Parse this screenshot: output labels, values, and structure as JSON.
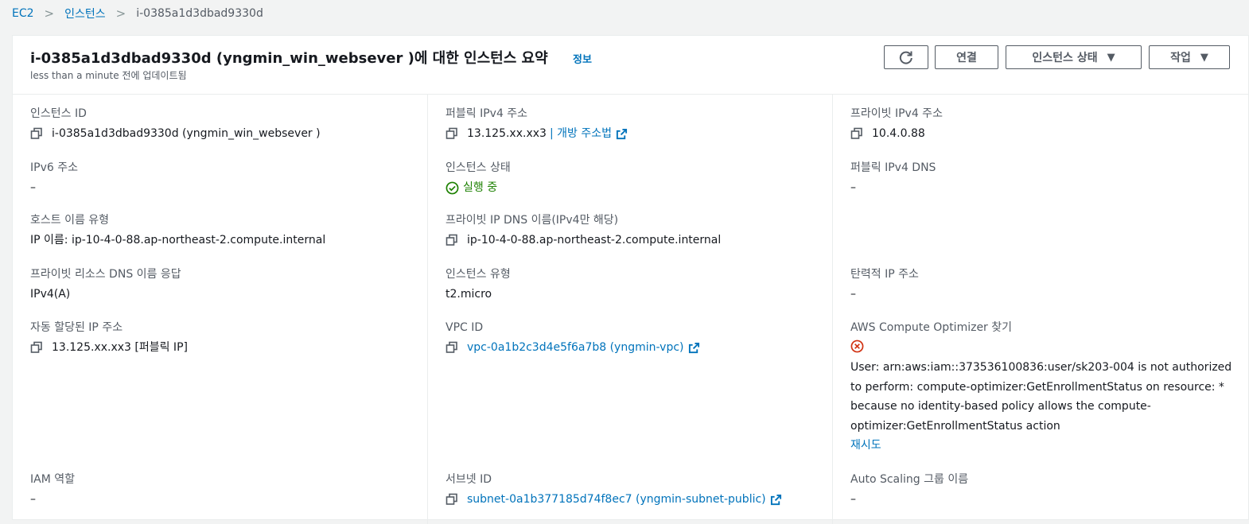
{
  "breadcrumb": {
    "ec2": "EC2",
    "instances": "인스턴스",
    "current": "i-0385a1d3dbad9330d",
    "separator": ">"
  },
  "header": {
    "title": "i-0385a1d3dbad9330d (yngmin_win_websever )에 대한 인스턴스 요약",
    "info_link": "정보",
    "updated": "less than a minute 전에 업데이트됨",
    "refresh_icon": "refresh-icon",
    "connect_button": "연결",
    "instance_state_button": "인스턴스 상태",
    "actions_button": "작업",
    "dropdown_icon": "▼"
  },
  "colors": {
    "link": "#0073bb",
    "success": "#1d8102",
    "error": "#d13212",
    "label": "#545b64",
    "text": "#16191f"
  },
  "details": {
    "instance_id": {
      "label": "인스턴스 ID",
      "value": "i-0385a1d3dbad9330d (yngmin_win_websever )"
    },
    "public_ipv4": {
      "label": "퍼블릭 IPv4 주소",
      "value": "13.125.xx.xx3",
      "link": "| 개방 주소법"
    },
    "private_ipv4": {
      "label": "프라이빗 IPv4 주소",
      "value": "10.4.0.88"
    },
    "ipv6": {
      "label": "IPv6 주소",
      "value": "–"
    },
    "instance_state": {
      "label": "인스턴스 상태",
      "value": "실행 중"
    },
    "public_dns": {
      "label": "퍼블릭 IPv4 DNS",
      "value": "–"
    },
    "hostname_type": {
      "label": "호스트 이름 유형",
      "value": "IP 이름: ip-10-4-0-88.ap-northeast-2.compute.internal"
    },
    "private_ip_dns": {
      "label": "프라이빗 IP DNS 이름(IPv4만 해당)",
      "value": "ip-10-4-0-88.ap-northeast-2.compute.internal"
    },
    "private_resource_dns": {
      "label": "프라이빗 리소스 DNS 이름 응답",
      "value": "IPv4(A)"
    },
    "instance_type": {
      "label": "인스턴스 유형",
      "value": "t2.micro"
    },
    "elastic_ip": {
      "label": "탄력적 IP 주소",
      "value": "–"
    },
    "auto_ip": {
      "label": "자동 할당된 IP 주소",
      "value": "13.125.xx.xx3 [퍼블릭 IP]"
    },
    "vpc_id": {
      "label": "VPC ID",
      "value": "vpc-0a1b2c3d4e5f6a7b8 (yngmin-vpc)"
    },
    "compute_optimizer": {
      "label": "AWS Compute Optimizer 찾기",
      "error": "User: arn:aws:iam::373536100836:user/sk203-004 is not authorized to perform: compute-optimizer:GetEnrollmentStatus on resource: * because no identity-based policy allows the compute-optimizer:GetEnrollmentStatus action",
      "retry": "재시도"
    },
    "iam_role": {
      "label": "IAM 역할",
      "value": "–"
    },
    "subnet_id": {
      "label": "서브넷 ID",
      "value": "subnet-0a1b377185d74f8ec7 (yngmin-subnet-public)"
    },
    "asg_name": {
      "label": "Auto Scaling 그룹 이름",
      "value": "–"
    }
  }
}
